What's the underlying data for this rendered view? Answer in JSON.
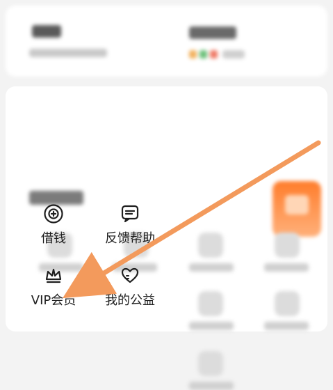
{
  "services": {
    "borrow": {
      "label": "借钱",
      "icon": "money-bag-icon"
    },
    "feedback": {
      "label": "反馈帮助",
      "icon": "feedback-icon"
    },
    "vip": {
      "label": "VIP会员",
      "icon": "crown-icon"
    },
    "charity": {
      "label": "我的公益",
      "icon": "heart-icon"
    }
  },
  "colors": {
    "arrow": "#f39a5c",
    "accent": "#ff7d2c",
    "chip_1": "#f2b15d",
    "chip_2": "#6cc07a",
    "chip_3": "#ef7a66"
  }
}
